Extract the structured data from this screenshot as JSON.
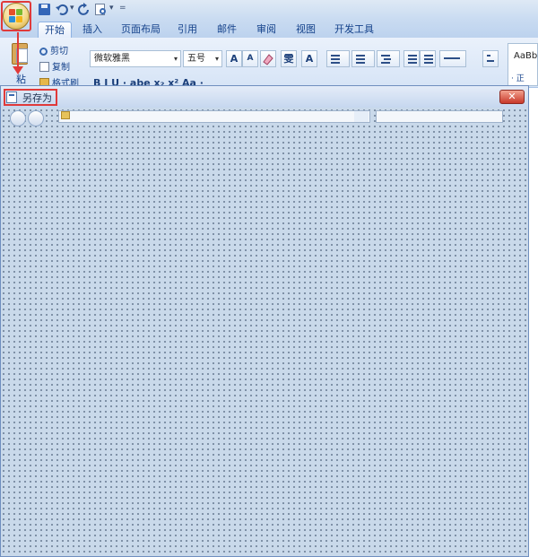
{
  "qat": {
    "undo_drop": "▾",
    "redo_drop": "▾",
    "customize": "="
  },
  "tabs": [
    {
      "label": "开始"
    },
    {
      "label": "插入"
    },
    {
      "label": "页面布局"
    },
    {
      "label": "引用"
    },
    {
      "label": "邮件"
    },
    {
      "label": "审阅"
    },
    {
      "label": "视图"
    },
    {
      "label": "开发工具"
    }
  ],
  "clipboard": {
    "paste_label": "粘贴",
    "cut_label": "剪切",
    "copy_label": "复制",
    "format_painter_label": "格式刷"
  },
  "font": {
    "font_name": "微软雅黑",
    "font_size": "五号",
    "grow_label": "A",
    "shrink_label": "A",
    "wen_label": "雯",
    "border_label": "A",
    "row2_text": "B I U · abe x₂ x² Aa ·"
  },
  "styles": {
    "preview_label": "AaBb",
    "normal_label": "· 正"
  },
  "dialog": {
    "title": "另存为",
    "close_symbol": "✕"
  },
  "colors": {
    "annotation_red": "#e03a3a",
    "ribbon_blue": "#15428b"
  }
}
